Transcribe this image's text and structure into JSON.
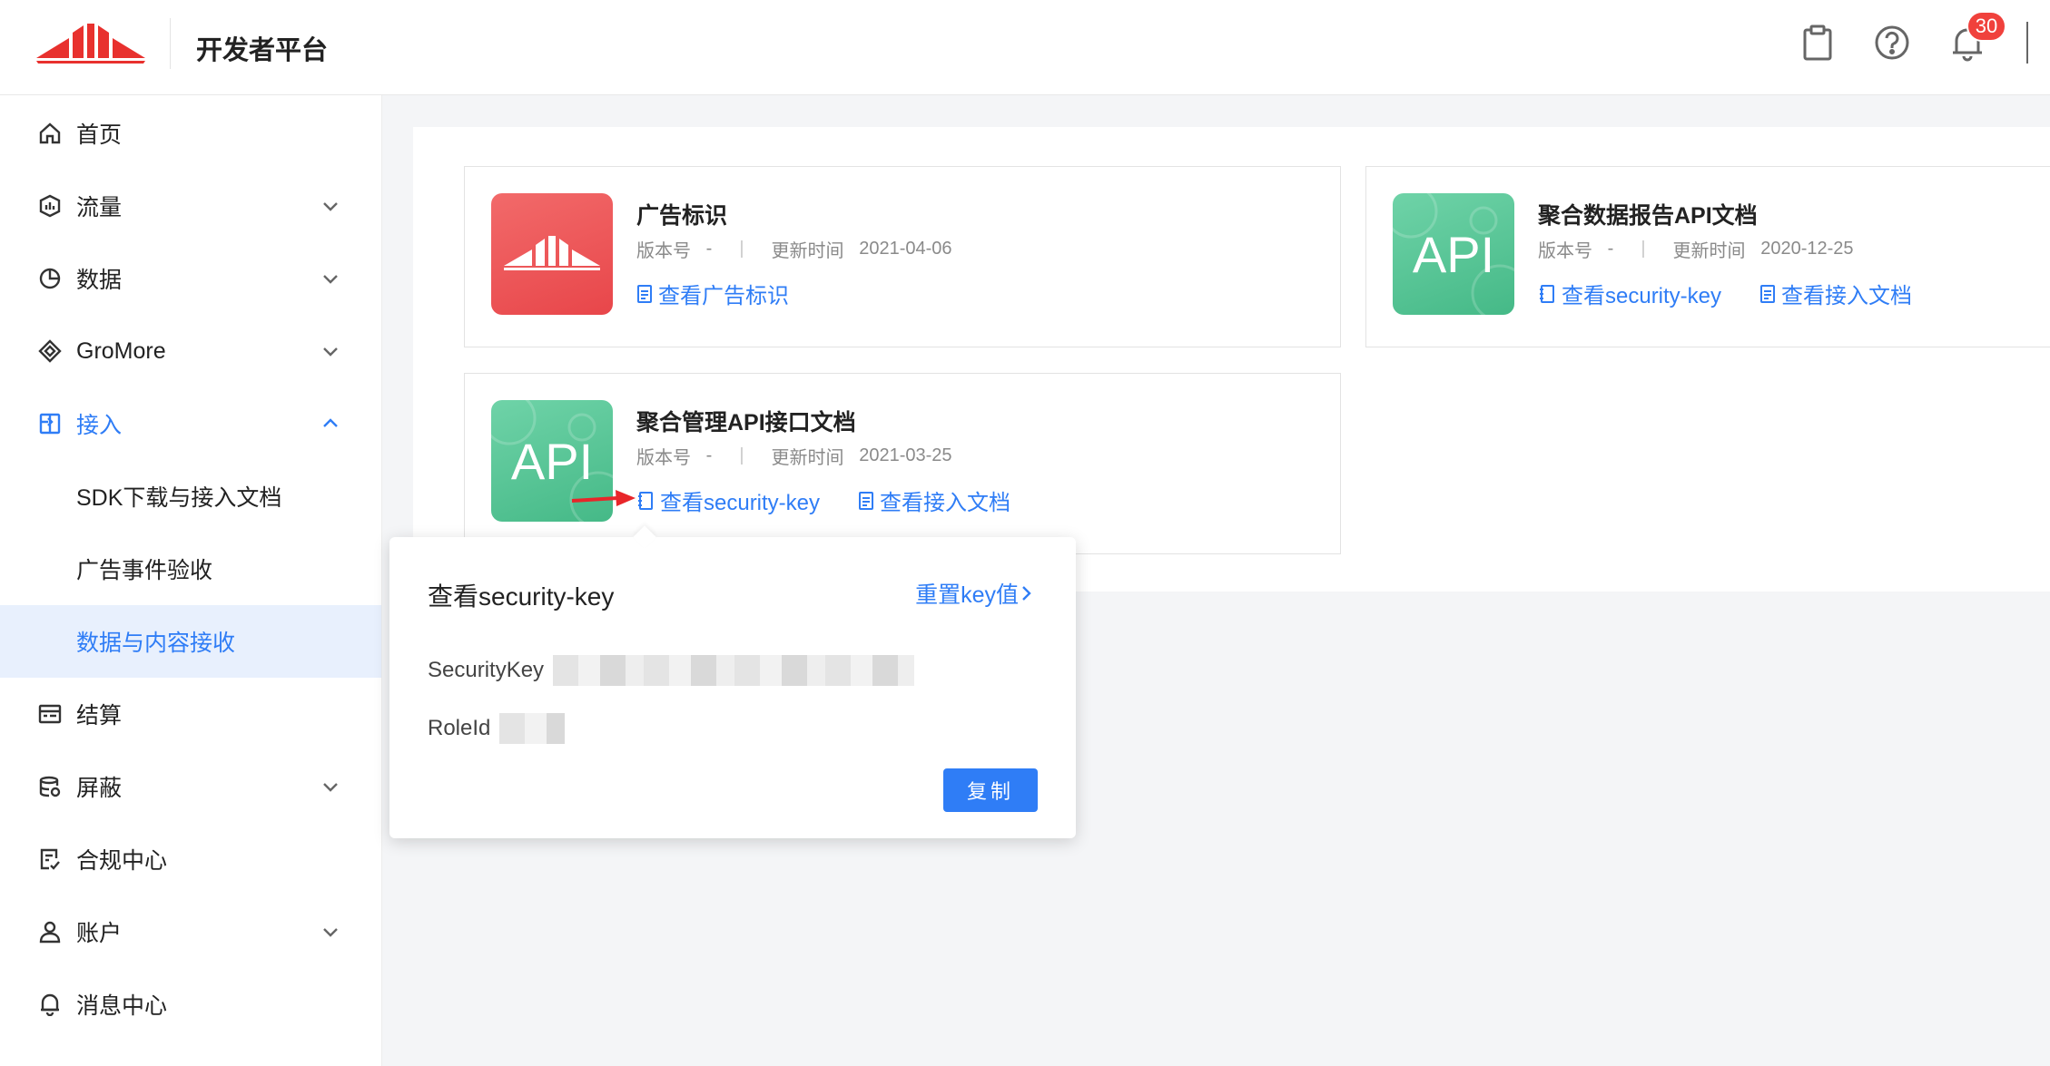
{
  "header": {
    "platform_title": "开发者平台",
    "notification_count": "30",
    "icons": [
      "clipboard-icon",
      "help-icon",
      "bell-icon"
    ]
  },
  "sidebar": {
    "items": [
      {
        "label": "首页",
        "icon": "home-icon"
      },
      {
        "label": "流量",
        "icon": "traffic-icon"
      },
      {
        "label": "数据",
        "icon": "pie-chart-icon"
      },
      {
        "label": "GroMore",
        "icon": "gromore-icon"
      },
      {
        "label": "接入",
        "icon": "access-icon"
      },
      {
        "label": "结算",
        "icon": "settlement-icon"
      },
      {
        "label": "屏蔽",
        "icon": "database-icon"
      },
      {
        "label": "合规中心",
        "icon": "compliance-icon"
      },
      {
        "label": "账户",
        "icon": "user-icon"
      },
      {
        "label": "消息中心",
        "icon": "bell-icon"
      }
    ],
    "sub_items": [
      {
        "label": "SDK下载与接入文档"
      },
      {
        "label": "广告事件验收"
      },
      {
        "label": "数据与内容接收"
      }
    ]
  },
  "docs": [
    {
      "title": "广告标识",
      "version_label": "版本号",
      "version": "-",
      "updated_label": "更新时间",
      "updated": "2021-04-06",
      "links": [
        "查看广告标识"
      ]
    },
    {
      "title": "聚合数据报告API文档",
      "version_label": "版本号",
      "version": "-",
      "updated_label": "更新时间",
      "updated": "2020-12-25",
      "thumb_text": "API",
      "links": [
        "查看security-key",
        "查看接入文档"
      ]
    },
    {
      "title": "聚合管理API接口文档",
      "version_label": "版本号",
      "version": "-",
      "updated_label": "更新时间",
      "updated": "2021-03-25",
      "thumb_text": "API",
      "links": [
        "查看security-key",
        "查看接入文档"
      ]
    }
  ],
  "popover": {
    "title": "查看security-key",
    "reset_label": "重置key值",
    "security_key_label": "SecurityKey",
    "role_id_label": "RoleId",
    "copy_label": "复制"
  },
  "colors": {
    "accent": "#2f7df6",
    "brand_red": "#e8312e",
    "badge": "#f0413c",
    "api_green": "#52c495"
  }
}
